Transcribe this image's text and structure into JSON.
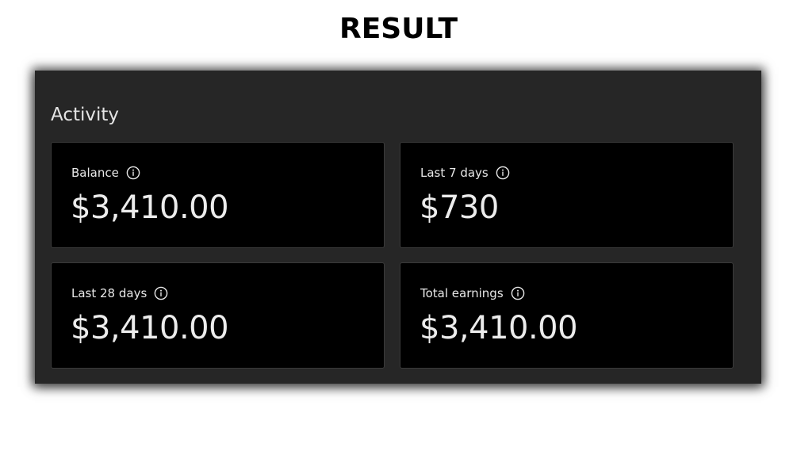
{
  "heading": "RESULT",
  "activity": {
    "title": "Activity",
    "cards": [
      {
        "label": "Balance",
        "value": "$3,410.00"
      },
      {
        "label": "Last 7 days",
        "value": "$730"
      },
      {
        "label": "Last 28 days",
        "value": "$3,410.00"
      },
      {
        "label": "Total earnings",
        "value": "$3,410.00"
      }
    ]
  },
  "icons": {
    "info": "info-circle-icon"
  },
  "colors": {
    "panel_background": "#262626",
    "card_background": "#000000",
    "text": "#e8e8e8"
  }
}
